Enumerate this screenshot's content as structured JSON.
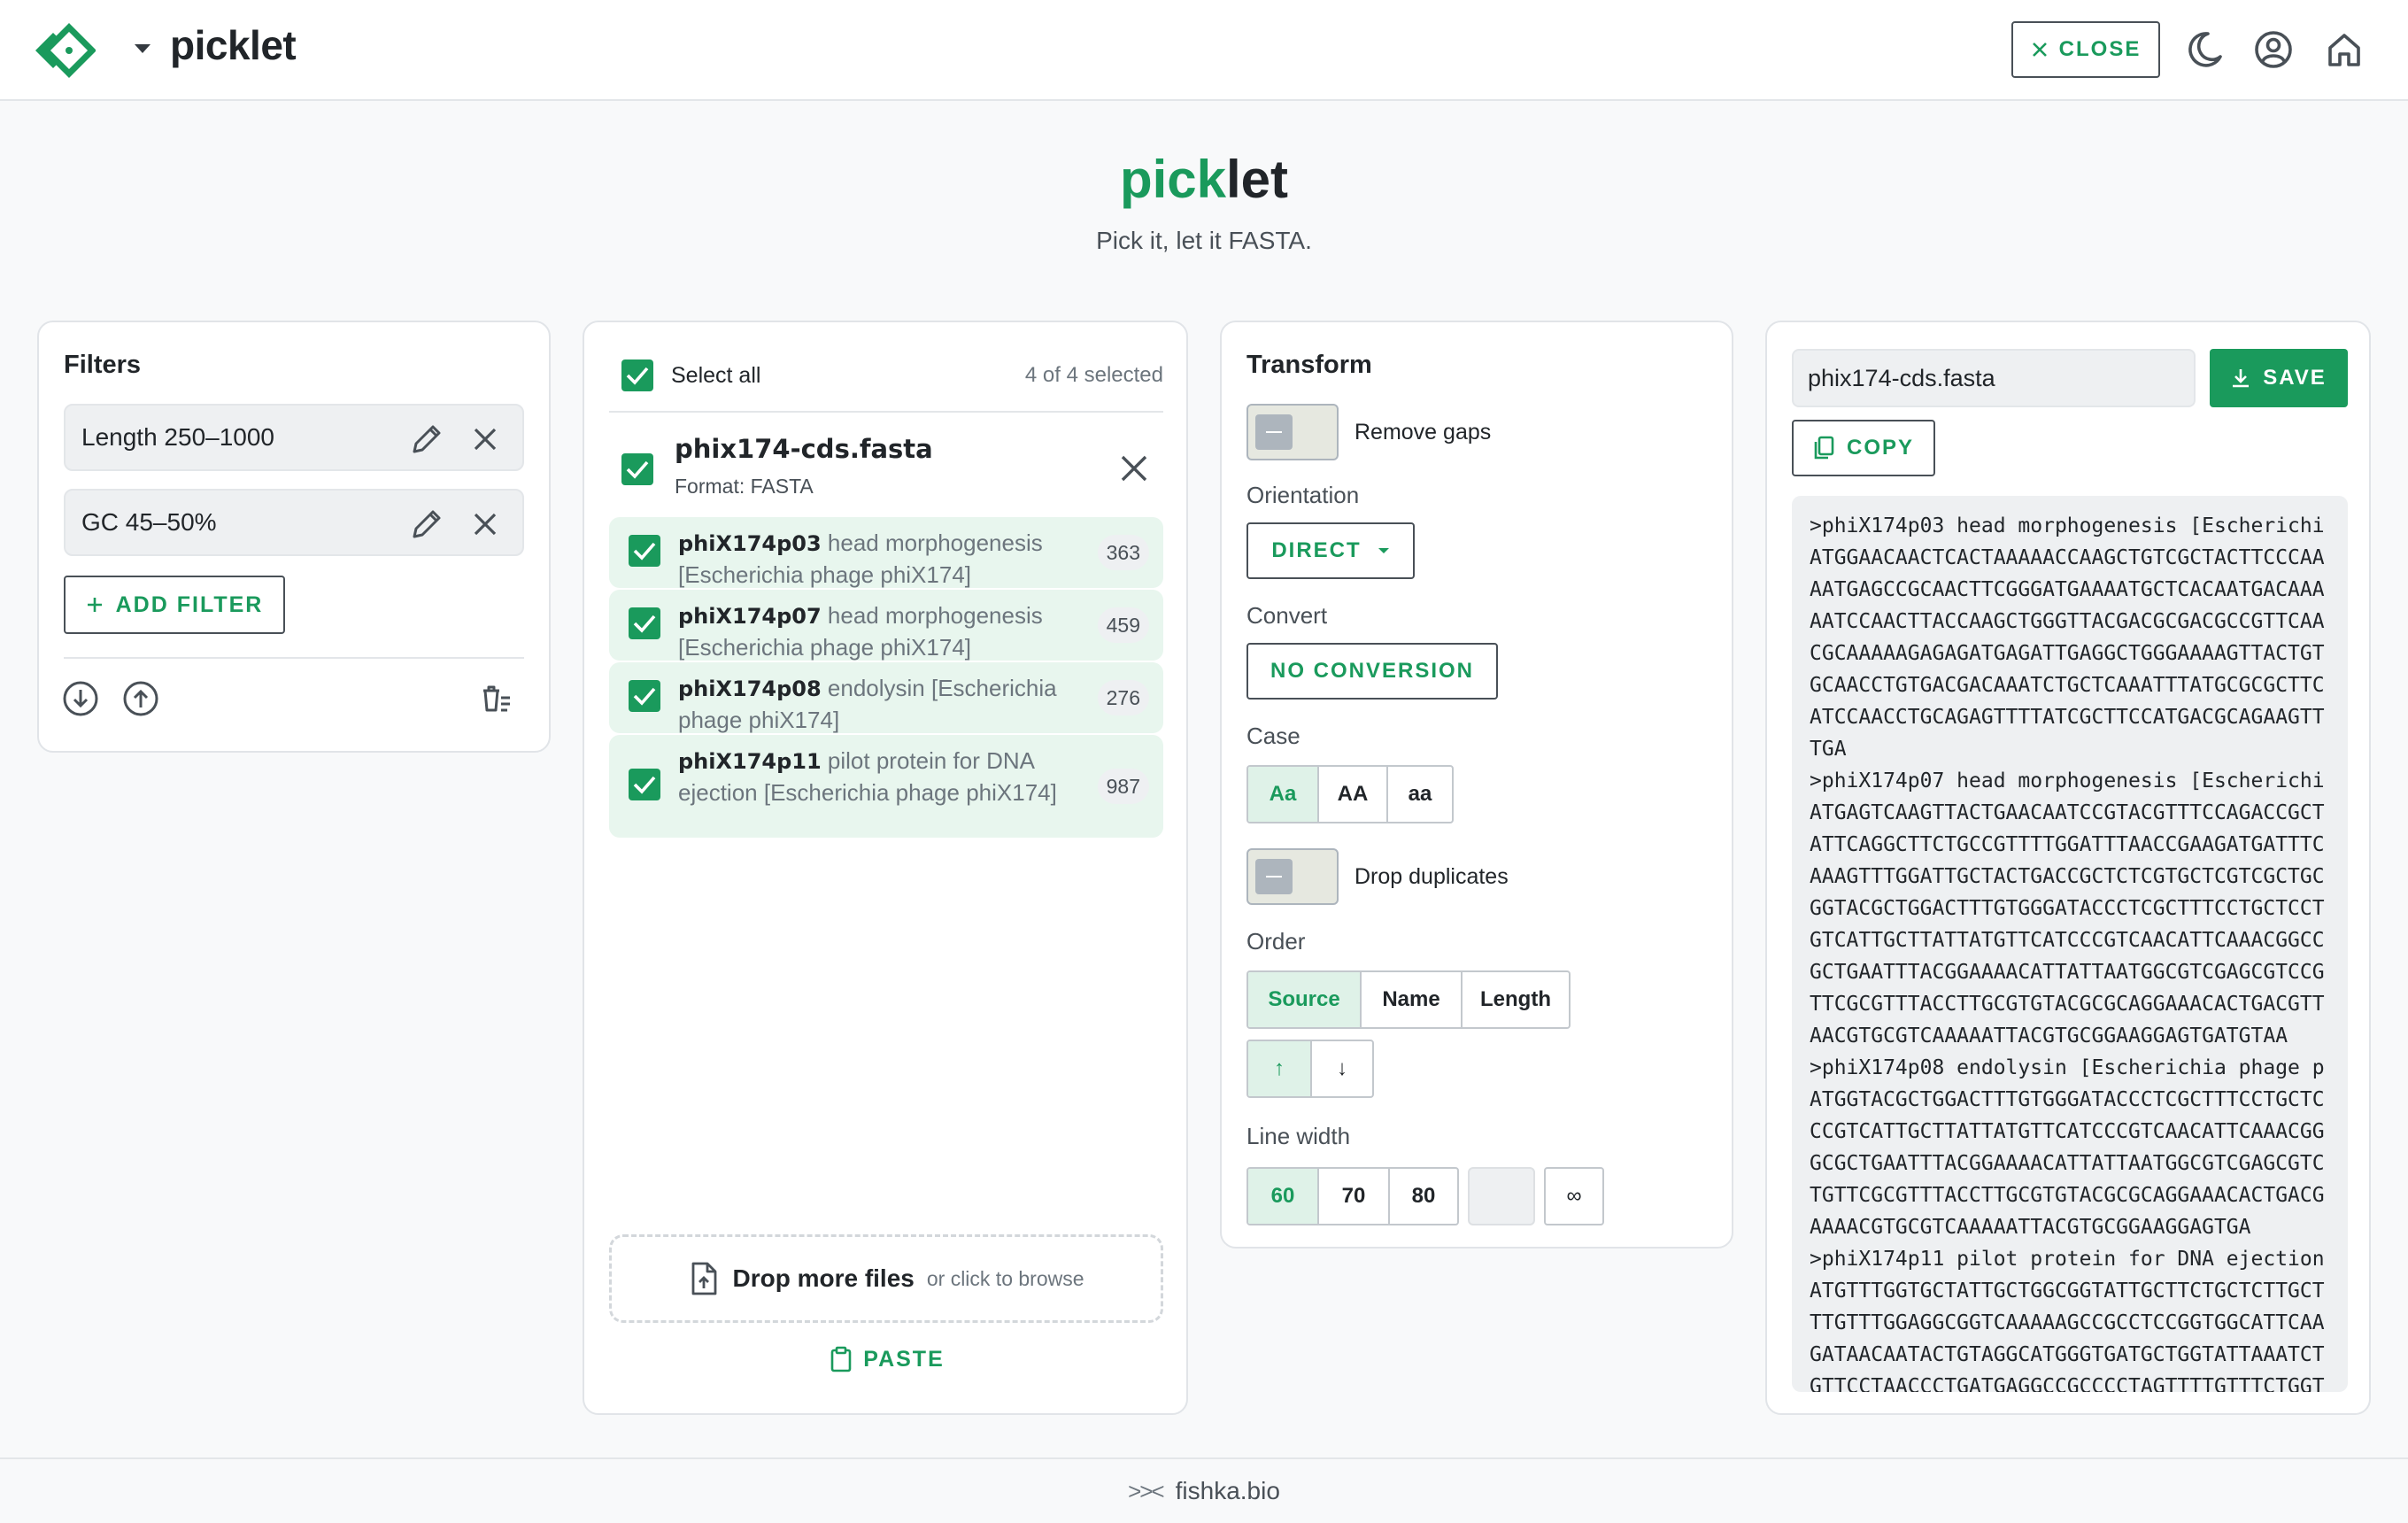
{
  "header": {
    "app_name": "picklet",
    "close_label": "CLOSE",
    "icons": [
      "logo-icon",
      "caret-down-icon",
      "close-x-icon",
      "moon-icon",
      "account-circle-icon",
      "home-icon"
    ]
  },
  "hero": {
    "title_green": "pick",
    "title_dark": "let",
    "subtitle": "Pick it, let it FASTA."
  },
  "filters": {
    "title": "Filters",
    "items": [
      {
        "label": "Length 250–1000"
      },
      {
        "label": "GC 45–50%"
      }
    ],
    "add_label": "ADD FILTER"
  },
  "files": {
    "select_all_label": "Select all",
    "selected_count": "4 of 4 selected",
    "file_name": "phix174-cds.fasta",
    "file_format": "Format: FASTA",
    "sequences": [
      {
        "id": "phiX174p03",
        "desc": "head morphogenesis [Escherichia phage phiX174]",
        "length": "363"
      },
      {
        "id": "phiX174p07",
        "desc": "head morphogenesis [Escherichia phage phiX174]",
        "length": "459"
      },
      {
        "id": "phiX174p08",
        "desc": "endolysin [Escherichia phage phiX174]",
        "length": "276"
      },
      {
        "id": "phiX174p11",
        "desc": "pilot protein for DNA ejection [Escherichia phage phiX174]",
        "length": "987"
      }
    ],
    "drop_main": "Drop more files",
    "drop_sub": "or click to browse",
    "paste_label": "PASTE"
  },
  "transform": {
    "title": "Transform",
    "remove_gaps_label": "Remove gaps",
    "orientation_label": "Orientation",
    "orientation_value": "DIRECT",
    "convert_label": "Convert",
    "convert_value": "NO CONVERSION",
    "case_label": "Case",
    "case_options": [
      "Aa",
      "AA",
      "aa"
    ],
    "case_selected": "Aa",
    "drop_duplicates_label": "Drop duplicates",
    "order_label": "Order",
    "order_options": [
      "Source",
      "Name",
      "Length"
    ],
    "order_selected": "Source",
    "direction_up": "↑",
    "direction_down": "↓",
    "line_width_label": "Line width",
    "line_width_options": [
      "60",
      "70",
      "80"
    ],
    "line_width_selected": "60",
    "line_width_infinite": "∞"
  },
  "output": {
    "filename": "phix174-cds.fasta",
    "save_label": "SAVE",
    "copy_label": "COPY",
    "text": ">phiX174p03 head morphogenesis [Escherichi\nATGGAACAACTCACTAAAAACCAAGCTGTCGCTACTTCCCAA\nAATGAGCCGCAACTTCGGGATGAAAATGCTCACAATGACAAA\nAATCCAACTTACCAAGCTGGGTTACGACGCGACGCCGTTCAA\nCGCAAAAAGAGAGATGAGATTGAGGCTGGGAAAAGTTACTGT\nGCAACCTGTGACGACAAATCTGCTCAAATTTATGCGCGCTTC\nATCCAACCTGCAGAGTTTTATCGCTTCCATGACGCAGAAGTT\nTGA\n>phiX174p07 head morphogenesis [Escherichi\nATGAGTCAAGTTACTGAACAATCCGTACGTTTCCAGACCGCT\nATTCAGGCTTCTGCCGTTTTGGATTTAACCGAAGATGATTTC\nAAAGTTTGGATTGCTACTGACCGCTCTCGTGCTCGTCGCTGC\nGGTACGCTGGACTTTGTGGGATACCCTCGCTTTCCTGCTCCT\nGTCATTGCTTATTATGTTCATCCCGTCAACATTCAAACGGCC\nGCTGAATTTACGGAAAACATTATTAATGGCGTCGAGCGTCCG\nTTCGCGTTTACCTTGCGTGTACGCGCAGGAAACACTGACGTT\nAACGTGCGTCAAAAATTACGTGCGGAAGGAGTGATGTAA\n>phiX174p08 endolysin [Escherichia phage p\nATGGTACGCTGGACTTTGTGGGATACCCTCGCTTTCCTGCTC\nCCGTCATTGCTTATTATGTTCATCCCGTCAACATTCAAACGG\nGCGCTGAATTTACGGAAAACATTATTAATGGCGTCGAGCGTC\nTGTTCGCGTTTACCTTGCGTGTACGCGCAGGAAACACTGACG\nAAAACGTGCGTCAAAAATTACGTGCGGAAGGAGTGA\n>phiX174p11 pilot protein for DNA ejection\nATGTTTGGTGCTATTGCTGGCGGTATTGCTTCTGCTCTTGCT\nTTGTTTGGAGGCGGTCAAAAAGCCGCCTCCGGTGGCATTCAA\nGATAACAATACTGTAGGCATGGGTGATGCTGGTATTAAATCT\nGTTCCTAACCCTGATGAGGCCGCCCCTAGTTTTGTTTCTGGT"
  },
  "footer": {
    "icon_text": ">><",
    "label": "fishka.bio"
  }
}
